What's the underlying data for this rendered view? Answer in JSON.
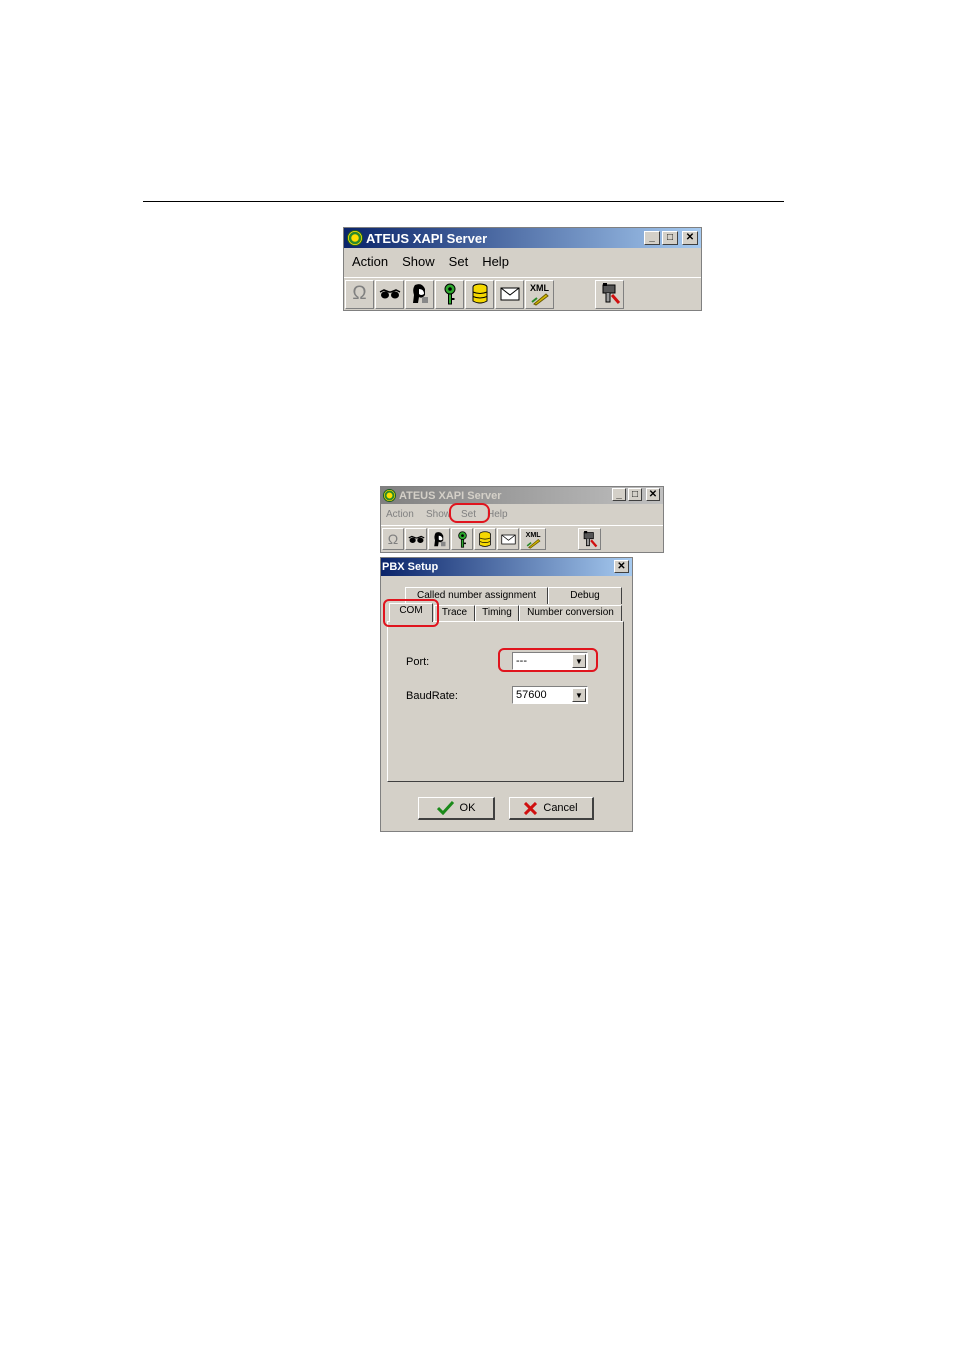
{
  "window1": {
    "title": "ATEUS XAPI Server",
    "menu": [
      "Action",
      "Show",
      "Set",
      "Help"
    ],
    "toolbar_icons": [
      "omega-icon",
      "glasses-icon",
      "user-icon",
      "key-icon",
      "database-icon",
      "mail-icon",
      "xml-icon",
      "settings-tool-icon"
    ]
  },
  "window2": {
    "title": "ATEUS XAPI Server",
    "menu": [
      "Action",
      "Show",
      "Set",
      "Help"
    ]
  },
  "dialog": {
    "title": "PBX Setup",
    "tabs_back": [
      "Called number assignment",
      "Debug"
    ],
    "tabs_front": [
      "COM",
      "Trace",
      "Timing",
      "Number conversion"
    ],
    "port_label": "Port:",
    "port_value": "---",
    "baud_label": "BaudRate:",
    "baud_value": "57600",
    "ok_label": "OK",
    "cancel_label": "Cancel"
  },
  "highlight_color": "#e0141e"
}
